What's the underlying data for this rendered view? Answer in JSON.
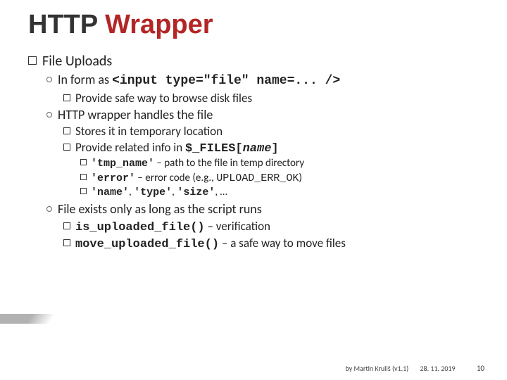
{
  "title": {
    "part1": "HTTP ",
    "part2": "Wrapper"
  },
  "l1": {
    "label_span1": "File",
    "label_span2": " Uploads"
  },
  "l2a": {
    "prefix": "In form as ",
    "code": "<input type=\"file\" name=... />"
  },
  "l3a": "Provide safe way to browse disk files",
  "l2b": "HTTP wrapper handles the file",
  "l3b": "Stores it in temporary location",
  "l3c": {
    "prefix": "Provide related info in ",
    "code1": "$_FILES[",
    "var": "name",
    "code2": "]"
  },
  "l4a": {
    "code": "'tmp_name'",
    "rest": " – path to the file in temp directory"
  },
  "l4b": {
    "code": "'error'",
    "mid": " – error code (e.g., ",
    "ok": "UPLOAD_ERR_OK",
    "end": ")"
  },
  "l4c": {
    "c1": "'name'",
    "sep1": ", ",
    "c2": "'type'",
    "sep2": ", ",
    "c3": "'size'",
    "rest": ", …"
  },
  "l2c": "File exists only as long as the script runs",
  "l3d": {
    "code": "is_uploaded_file()",
    "rest": " – verification"
  },
  "l3e": {
    "code": "move_uploaded_file()",
    "rest": " – a safe way to move files"
  },
  "footer": {
    "author": "by Martin Kruliš (v1.1)",
    "date": "28. 11. 2019",
    "page": "10"
  }
}
